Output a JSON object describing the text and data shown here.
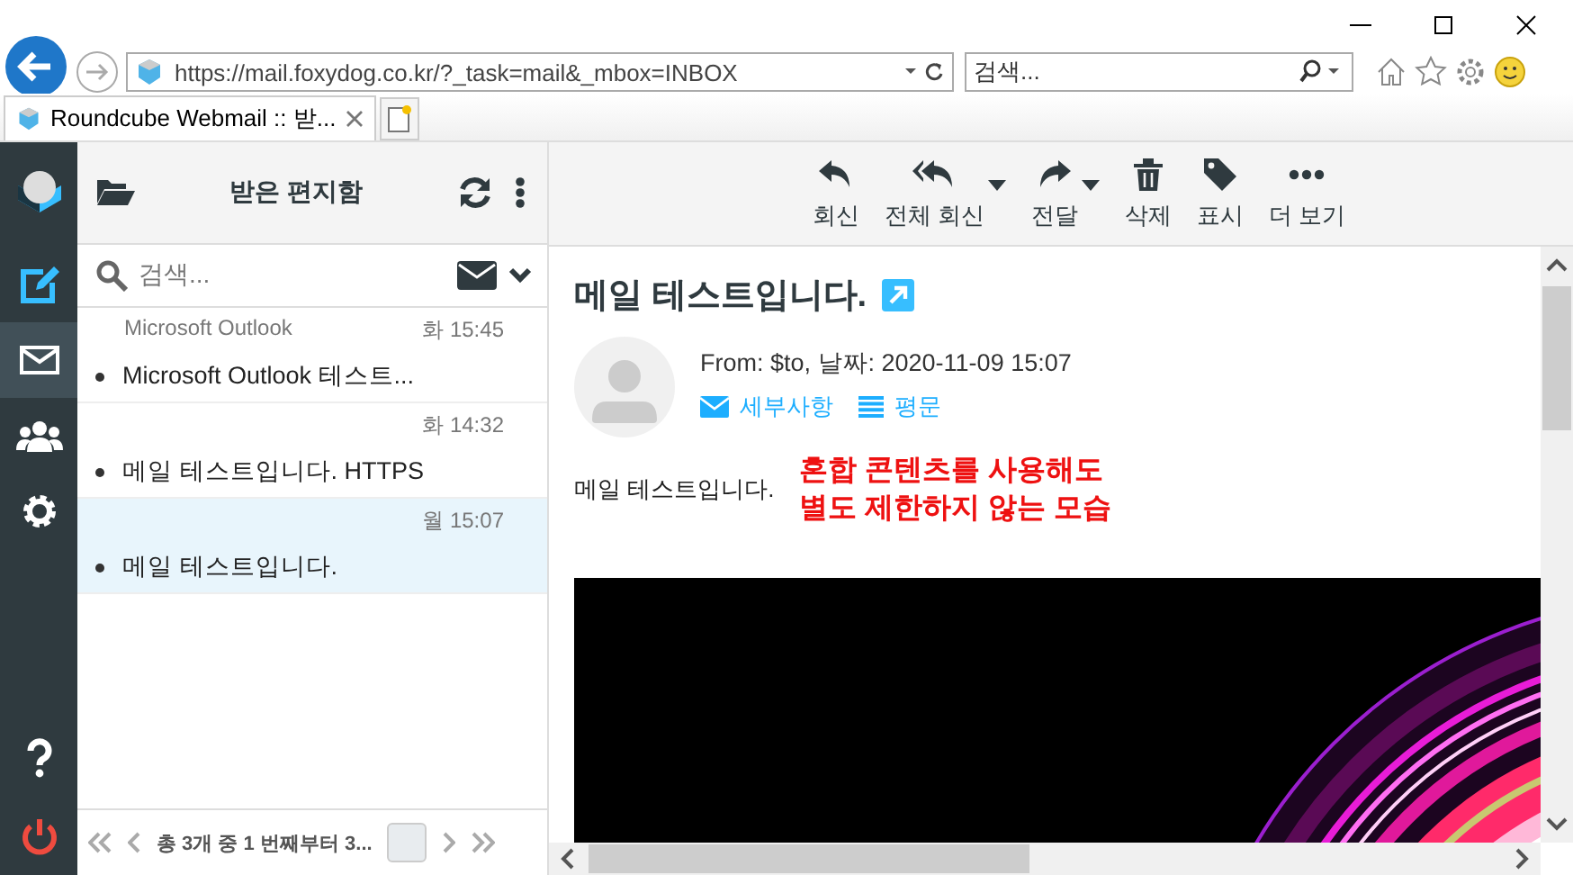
{
  "browser": {
    "url": "https://mail.foxydog.co.kr/?_task=mail&_mbox=INBOX",
    "search_placeholder": "검색...",
    "tabs": [
      {
        "title": "Roundcube Webmail :: 받...",
        "selected": true
      }
    ]
  },
  "rail": {
    "items": [
      {
        "kind": "compose",
        "selected": false
      },
      {
        "kind": "mail",
        "selected": true
      },
      {
        "kind": "contacts",
        "selected": false
      },
      {
        "kind": "settings",
        "selected": false
      },
      {
        "kind": "help",
        "selected": false
      },
      {
        "kind": "logout",
        "selected": false
      }
    ]
  },
  "list": {
    "title": "받은 편지함",
    "search_placeholder": "검색...",
    "messages": [
      {
        "from": "Microsoft Outlook",
        "date": "화 15:45",
        "subject": "Microsoft Outlook 테스트...",
        "selected": false
      },
      {
        "date": "화 14:32",
        "subject": "메일 테스트입니다. HTTPS",
        "selected": false
      },
      {
        "date": "월 15:07",
        "subject": "메일 테스트입니다.",
        "selected": true
      }
    ],
    "pagination": "총 3개 중 1 번째부터 3..."
  },
  "toolbar": [
    {
      "kind": "reply",
      "label": "회신",
      "dropdown": false
    },
    {
      "kind": "reply-all",
      "label": "전체 회신",
      "dropdown": true
    },
    {
      "kind": "forward",
      "label": "전달",
      "dropdown": true
    },
    {
      "kind": "delete",
      "label": "삭제",
      "dropdown": false
    },
    {
      "kind": "mark",
      "label": "표시",
      "dropdown": false
    },
    {
      "kind": "more",
      "label": "더 보기",
      "dropdown": false
    }
  ],
  "message": {
    "subject": "메일 테스트입니다.",
    "header": "From: $to, 날짜: 2020-11-09 15:07",
    "links": [
      {
        "kind": "details",
        "label": "세부사항"
      },
      {
        "kind": "plain",
        "label": "평문"
      }
    ],
    "body": "메일 테스트입니다.",
    "annotation": [
      "혼합 콘텐츠를 사용해도",
      "별도 제한하지 않는 모습"
    ]
  }
}
